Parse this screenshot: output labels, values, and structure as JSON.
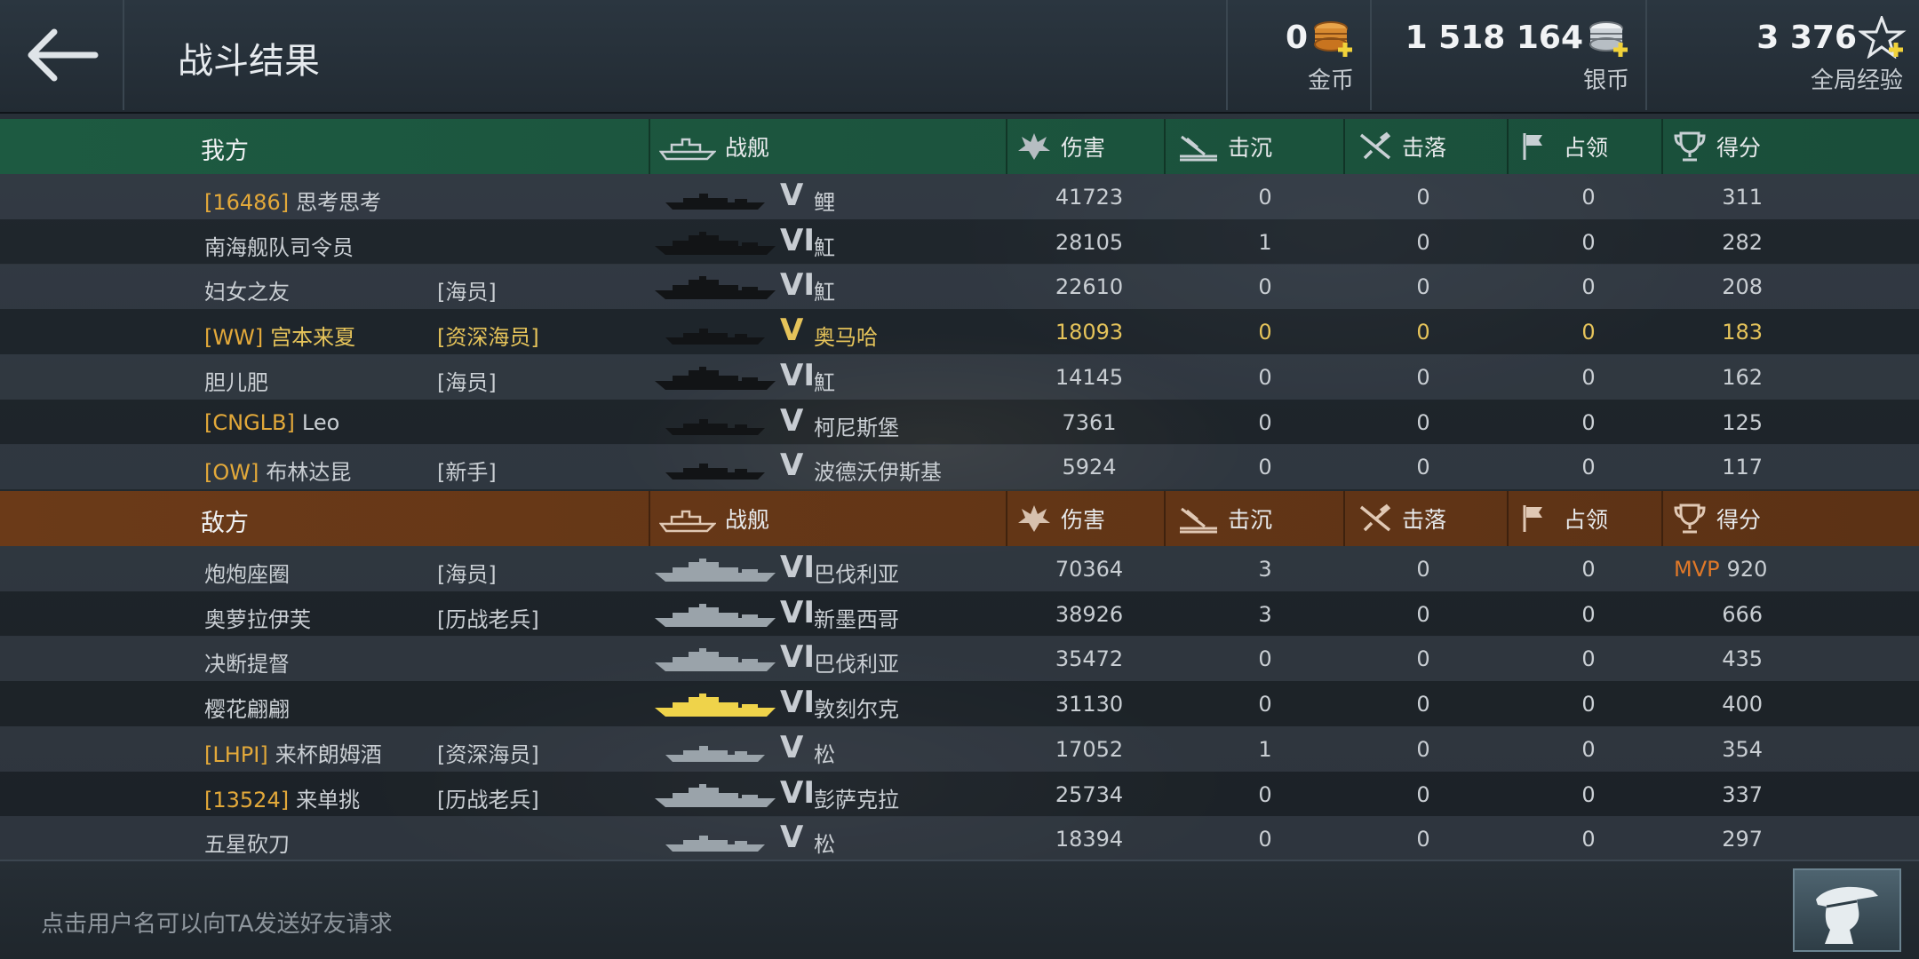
{
  "header": {
    "title": "战斗结果",
    "currencies": [
      {
        "value": "0",
        "label": "金币",
        "icon": "gold-coins-icon"
      },
      {
        "value": "1 518 164",
        "label": "银币",
        "icon": "silver-coins-icon"
      },
      {
        "value": "3 376",
        "label": "全局经验",
        "icon": "star-xp-icon"
      }
    ]
  },
  "columns": {
    "ship": "战舰",
    "damage": "伤害",
    "sunk": "击沉",
    "downed": "击落",
    "capture": "占领",
    "score": "得分"
  },
  "friendly": {
    "label": "我方",
    "players": [
      {
        "clan": "[16486]",
        "name": "思考思考",
        "rank": "",
        "tier": "V",
        "ship": "鲤",
        "damage": "41723",
        "sunk": "0",
        "downed": "0",
        "capture": "0",
        "score": "311",
        "mvp": ""
      },
      {
        "clan": "",
        "name": "南海舰队司令员",
        "rank": "",
        "tier": "VI",
        "ship": "魟",
        "damage": "28105",
        "sunk": "1",
        "downed": "0",
        "capture": "0",
        "score": "282",
        "mvp": ""
      },
      {
        "clan": "",
        "name": "妇女之友",
        "rank": "[海员]",
        "tier": "VI",
        "ship": "魟",
        "damage": "22610",
        "sunk": "0",
        "downed": "0",
        "capture": "0",
        "score": "208",
        "mvp": ""
      },
      {
        "clan": "[WW]",
        "name": "宫本来夏",
        "rank": "[资深海员]",
        "tier": "V",
        "ship": "奥马哈",
        "damage": "18093",
        "sunk": "0",
        "downed": "0",
        "capture": "0",
        "score": "183",
        "mvp": "",
        "me": true
      },
      {
        "clan": "",
        "name": "胆儿肥",
        "rank": "[海员]",
        "tier": "VI",
        "ship": "魟",
        "damage": "14145",
        "sunk": "0",
        "downed": "0",
        "capture": "0",
        "score": "162",
        "mvp": ""
      },
      {
        "clan": "[CNGLB]",
        "name": "Leo",
        "rank": "",
        "tier": "V",
        "ship": "柯尼斯堡",
        "damage": "7361",
        "sunk": "0",
        "downed": "0",
        "capture": "0",
        "score": "125",
        "mvp": ""
      },
      {
        "clan": "[OW]",
        "name": "布林达昆",
        "rank": "[新手]",
        "tier": "V",
        "ship": "波德沃伊斯基",
        "damage": "5924",
        "sunk": "0",
        "downed": "0",
        "capture": "0",
        "score": "117",
        "mvp": ""
      }
    ]
  },
  "enemy": {
    "label": "敌方",
    "players": [
      {
        "clan": "",
        "name": "炮炮座圈",
        "rank": "[海员]",
        "tier": "VI",
        "ship": "巴伐利亚",
        "damage": "70364",
        "sunk": "3",
        "downed": "0",
        "capture": "0",
        "score": "920",
        "mvp": "MVP"
      },
      {
        "clan": "",
        "name": "奥萝拉伊芙",
        "rank": "[历战老兵]",
        "tier": "VI",
        "ship": "新墨西哥",
        "damage": "38926",
        "sunk": "3",
        "downed": "0",
        "capture": "0",
        "score": "666",
        "mvp": ""
      },
      {
        "clan": "",
        "name": "决断提督",
        "rank": "",
        "tier": "VI",
        "ship": "巴伐利亚",
        "damage": "35472",
        "sunk": "0",
        "downed": "0",
        "capture": "0",
        "score": "435",
        "mvp": ""
      },
      {
        "clan": "",
        "name": "樱花翩翩",
        "rank": "",
        "tier": "VI",
        "ship": "敦刻尔克",
        "damage": "31130",
        "sunk": "0",
        "downed": "0",
        "capture": "0",
        "score": "400",
        "mvp": ""
      },
      {
        "clan": "[LHPI]",
        "name": "来杯朗姆酒",
        "rank": "[资深海员]",
        "tier": "V",
        "ship": "松",
        "damage": "17052",
        "sunk": "1",
        "downed": "0",
        "capture": "0",
        "score": "354",
        "mvp": ""
      },
      {
        "clan": "[13524]",
        "name": "来单挑",
        "rank": "[历战老兵]",
        "tier": "VI",
        "ship": "彭萨克拉",
        "damage": "25734",
        "sunk": "0",
        "downed": "0",
        "capture": "0",
        "score": "337",
        "mvp": ""
      },
      {
        "clan": "",
        "name": "五星砍刀",
        "rank": "",
        "tier": "V",
        "ship": "松",
        "damage": "18394",
        "sunk": "0",
        "downed": "0",
        "capture": "0",
        "score": "297",
        "mvp": ""
      }
    ]
  },
  "footer": {
    "hint": "点击用户名可以向TA发送好友请求",
    "commander_icon": "commander-icon"
  },
  "colors": {
    "friendly_header": "#1d5a41",
    "enemy_header": "#6b3a18",
    "highlight_player": "#e5c35a",
    "clan_tag": "#e3a93a",
    "mvp": "#e07828"
  }
}
